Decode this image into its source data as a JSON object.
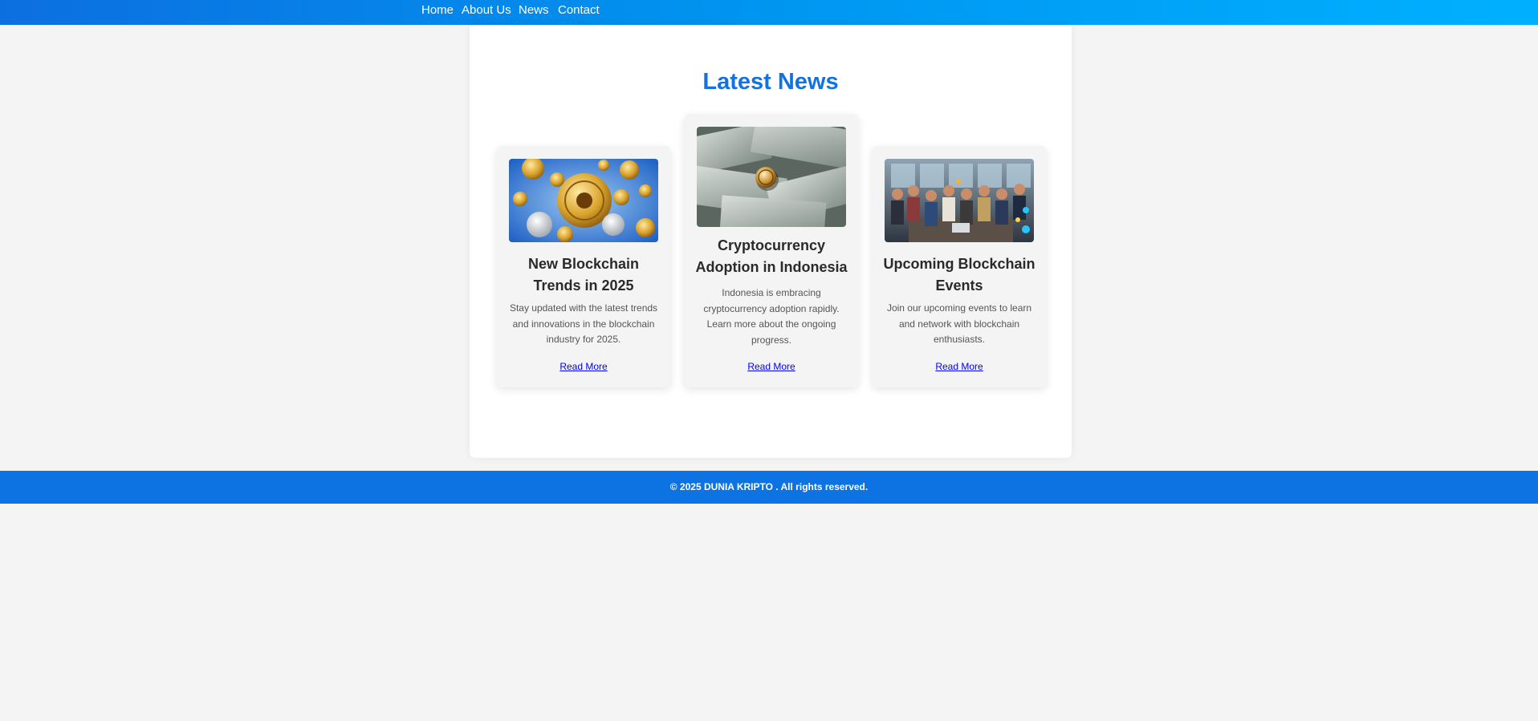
{
  "nav": {
    "items": [
      {
        "label": "Home"
      },
      {
        "label": "About Us"
      },
      {
        "label": "News"
      },
      {
        "label": "Contact"
      }
    ]
  },
  "main": {
    "title": "Latest News",
    "cards": [
      {
        "image_icon": "gold-crypto-coins-image",
        "title": "New Blockchain Trends in 2025",
        "text": "Stay updated with the latest trends and innovations in the blockchain industry for 2025.",
        "link": "Read More"
      },
      {
        "image_icon": "bitcoin-on-dollar-bills-image",
        "title": "Cryptocurrency Adoption in Indonesia",
        "text": "Indonesia is embracing cryptocurrency adoption rapidly. Learn more about the ongoing progress.",
        "link": "Read More"
      },
      {
        "image_icon": "people-at-blockchain-event-image",
        "title": "Upcoming Blockchain Events",
        "text": "Join our upcoming events to learn and network with blockchain enthusiasts.",
        "link": "Read More"
      }
    ]
  },
  "footer": {
    "text": "© 2025 DUNIA KRIPTO . All rights reserved."
  },
  "colors": {
    "nav_gradient_start": "#0c6fe0",
    "nav_gradient_end": "#00b0ff",
    "title": "#1273e0",
    "footer_bg": "#0d73e2",
    "link": "#0000ee",
    "page_bg": "#f4f4f4"
  }
}
